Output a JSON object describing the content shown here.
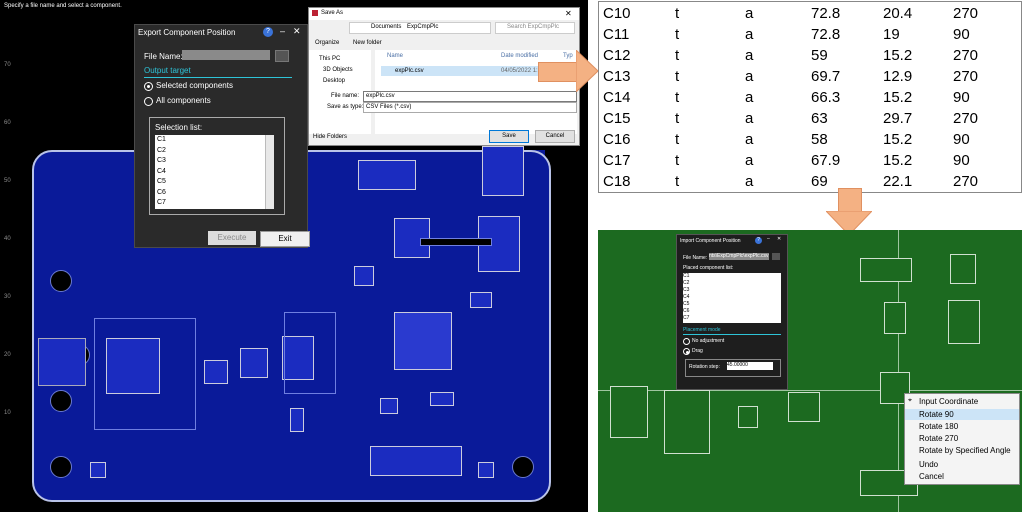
{
  "left_panel": {
    "hint": "Specify a file name and select a component.",
    "y_ticks": [
      "70",
      "60",
      "50",
      "40",
      "30",
      "20",
      "10"
    ],
    "board_color": "#0a1a99"
  },
  "export_dialog": {
    "title": "Export Component Position",
    "help_icon": "?",
    "file_name_label": "File Name:",
    "file_name_value": "",
    "output_target_label": "Output target",
    "option_selected": "Selected components",
    "option_all": "All components",
    "selection_list_label": "Selection list:",
    "selection_list": [
      "C1",
      "C2",
      "C3",
      "C4",
      "C5",
      "C6",
      "C7"
    ],
    "execute_label": "Execute",
    "exit_label": "Exit"
  },
  "save_dialog": {
    "title": "Save As",
    "path_this_pc": "Documents",
    "path_folder": "ExpCmpPlc",
    "search_placeholder": "Search ExpCmpPlc",
    "organize_label": "Organize",
    "new_folder_label": "New folder",
    "column_name": "Name",
    "column_date": "Date modified",
    "column_type": "Typ",
    "nav_items": [
      "This PC",
      "3D Objects",
      "Desktop"
    ],
    "file_row_name": "expPlc.csv",
    "file_row_date": "04/05/2022 1:",
    "file_name_label": "File name:",
    "file_name_value": "expPlc.csv",
    "save_as_type_label": "Save as type:",
    "save_as_type_value": "CSV Files (*.csv)",
    "hide_folders_label": "Hide Folders",
    "save_label": "Save",
    "cancel_label": "Cancel"
  },
  "csv_table": {
    "rows": [
      [
        "C10",
        "t",
        "a",
        "72.8",
        "20.4",
        "270"
      ],
      [
        "C11",
        "t",
        "a",
        "72.8",
        "19",
        "90"
      ],
      [
        "C12",
        "t",
        "a",
        "59",
        "15.2",
        "270"
      ],
      [
        "C13",
        "t",
        "a",
        "69.7",
        "12.9",
        "270"
      ],
      [
        "C14",
        "t",
        "a",
        "66.3",
        "15.2",
        "90"
      ],
      [
        "C15",
        "t",
        "a",
        "63",
        "29.7",
        "270"
      ],
      [
        "C16",
        "t",
        "a",
        "58",
        "15.2",
        "90"
      ],
      [
        "C17",
        "t",
        "a",
        "67.9",
        "15.2",
        "90"
      ],
      [
        "C18",
        "t",
        "a",
        "69",
        "22.1",
        "270"
      ]
    ]
  },
  "import_dialog": {
    "title": "Import Component Position",
    "help_icon": "?",
    "file_name_label": "File Name:",
    "file_name_value": "nts\\ExpCmpPlc\\expPlc.csv",
    "placed_list_label": "Placed component list:",
    "placed_list": [
      "C1",
      "C2",
      "C3",
      "C4",
      "C5",
      "C6",
      "C7"
    ],
    "placement_mode_label": "Placement mode",
    "option_no_adjustment": "No adjustment",
    "option_drag": "Drag",
    "rotation_step_label": "Rotation step:",
    "rotation_step_value": "45.00000"
  },
  "context_menu": {
    "items": [
      "Input Coordinate",
      "Rotate 90",
      "Rotate 180",
      "Rotate 270",
      "Rotate by Specified Angle",
      "Undo",
      "Cancel"
    ],
    "highlighted": "Rotate 90"
  },
  "colors": {
    "arrow": "#f4b183",
    "green_board": "#1c6a20",
    "accent": "#3a73d9"
  }
}
